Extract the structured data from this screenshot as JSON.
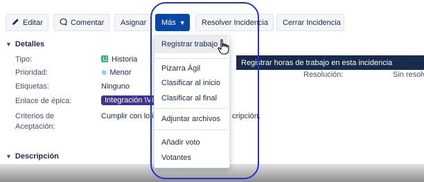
{
  "toolbar": {
    "edit_label": "Editar",
    "comment_label": "Comentar",
    "assign_label": "Asignar",
    "more_label": "Más",
    "resolve_label": "Resolver Incidencia",
    "close_label": "Cerrar Incidencia"
  },
  "details": {
    "heading": "Detalles",
    "fields": {
      "tipo": {
        "label": "Tipo:",
        "value": "Historia"
      },
      "prioridad": {
        "label": "Prioridad:",
        "value": "Menor"
      },
      "etiquetas": {
        "label": "Etiquetas:",
        "value": "Ninguno"
      },
      "epica": {
        "label": "Enlace de épica:",
        "value": "Integración \\Ví"
      },
      "criterios": {
        "label_line1": "Criterios de",
        "label_line2": "Aceptación:",
        "value": "Cumplir con lo i",
        "value_tail": "cripción."
      }
    },
    "resolution": {
      "label": "Resolución:",
      "value": "Sin resolve"
    }
  },
  "description": {
    "heading": "Descripción"
  },
  "more_menu": {
    "items": [
      {
        "label": "Registrar trabajo"
      },
      {
        "label": "Pizarra Ágil"
      },
      {
        "label": "Clasificar al inicio"
      },
      {
        "label": "Clasificar al final"
      },
      {
        "label": "Adjuntar archivos"
      },
      {
        "label": "Añadir voto"
      },
      {
        "label": "Votantes"
      }
    ]
  },
  "tooltip": {
    "text": "Registrar horas de trabajo en esta incidencia"
  },
  "colors": {
    "more_button": "#0747a6",
    "highlight_outline": "#1f2fe0",
    "story_icon": "#36b37e",
    "epic_tag": "#403294"
  }
}
